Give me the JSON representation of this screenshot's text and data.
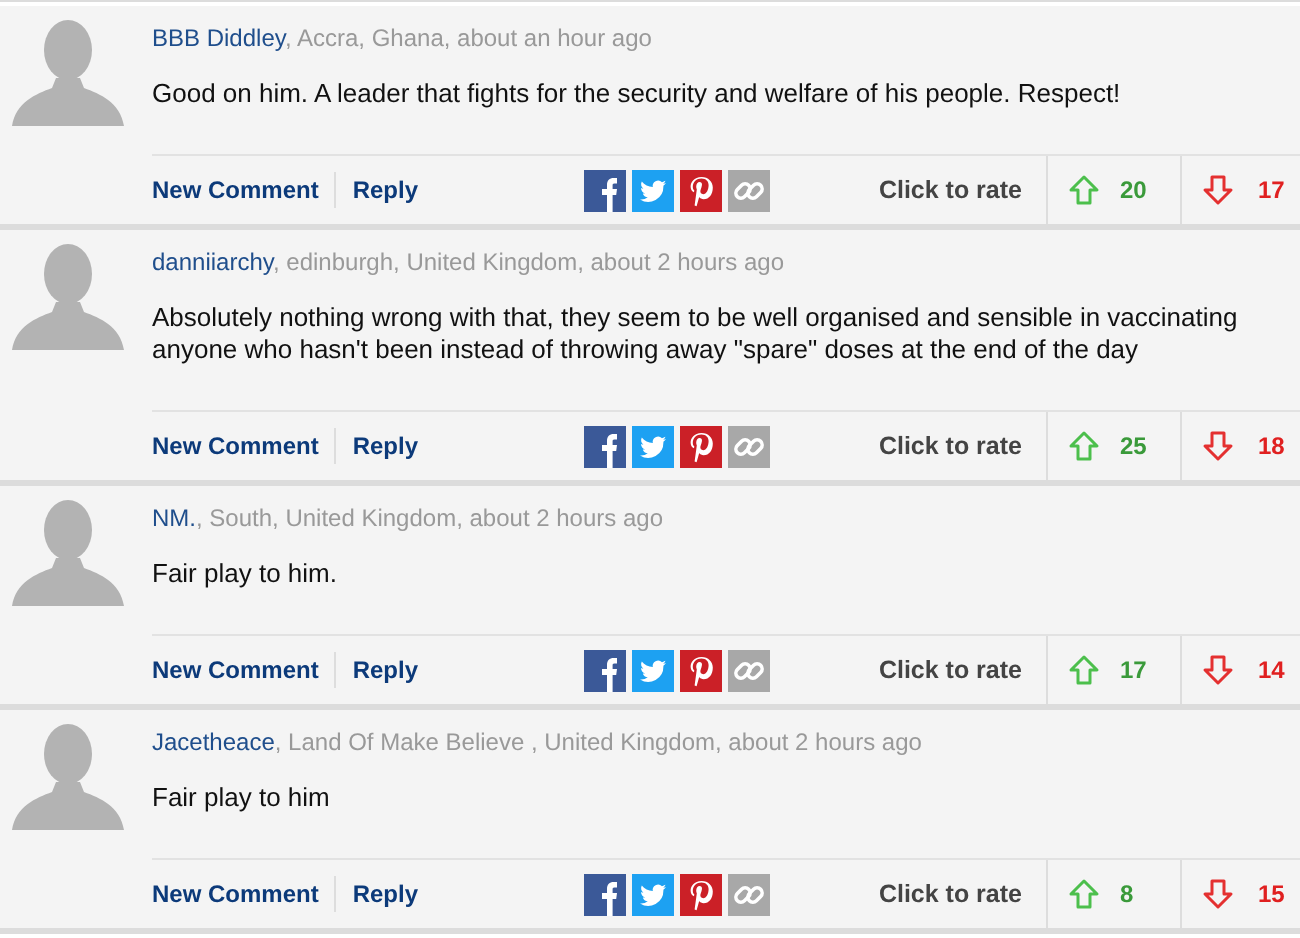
{
  "comments": [
    {
      "author": "BBB Diddley",
      "location": ", Accra, Ghana, about an hour ago",
      "body": "Good on him. A leader that fights for the security and welfare of his people. Respect!",
      "new_comment": "New Comment",
      "reply": "Reply",
      "rate_label": "Click to rate",
      "up_votes": "20",
      "down_votes": "17"
    },
    {
      "author": "danniiarchy",
      "location": ", edinburgh, United Kingdom, about 2 hours ago",
      "body": "Absolutely nothing wrong with that, they seem to be well organised and sensible in vaccinating anyone who hasn't been instead of throwing away \"spare\" doses at the end of the day",
      "new_comment": "New Comment",
      "reply": "Reply",
      "rate_label": "Click to rate",
      "up_votes": "25",
      "down_votes": "18"
    },
    {
      "author": "NM.",
      "location": ", South, United Kingdom, about 2 hours ago",
      "body": "Fair play to him.",
      "new_comment": "New Comment",
      "reply": "Reply",
      "rate_label": "Click to rate",
      "up_votes": "17",
      "down_votes": "14"
    },
    {
      "author": "Jacetheace",
      "location": ", Land Of Make Believe , United Kingdom, about 2 hours ago",
      "body": "Fair play to him",
      "new_comment": "New Comment",
      "reply": "Reply",
      "rate_label": "Click to rate",
      "up_votes": "8",
      "down_votes": "15"
    }
  ]
}
